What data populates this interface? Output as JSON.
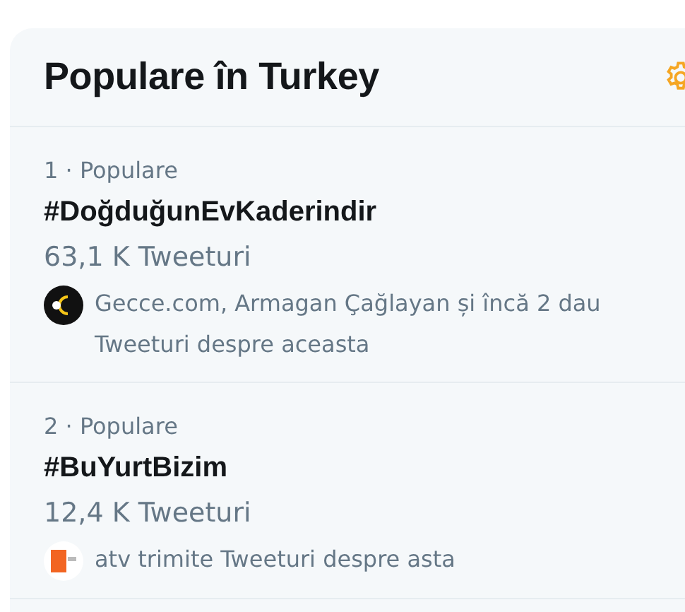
{
  "panel": {
    "title": "Populare în Turkey"
  },
  "trends": [
    {
      "rank_label": "1 · Populare",
      "hashtag": "#DoğduğunEvKaderindir",
      "count": "63,1 K Tweeturi",
      "context": "Gecce.com, Armagan Çağlayan și încă 2 dau Tweeturi despre aceasta",
      "avatar": {
        "kind": "dark"
      }
    },
    {
      "rank_label": "2 · Populare",
      "hashtag": "#BuYurtBizim",
      "count": "12,4 K Tweeturi",
      "context": "atv trimite Tweeturi despre asta",
      "avatar": {
        "kind": "light"
      }
    }
  ]
}
